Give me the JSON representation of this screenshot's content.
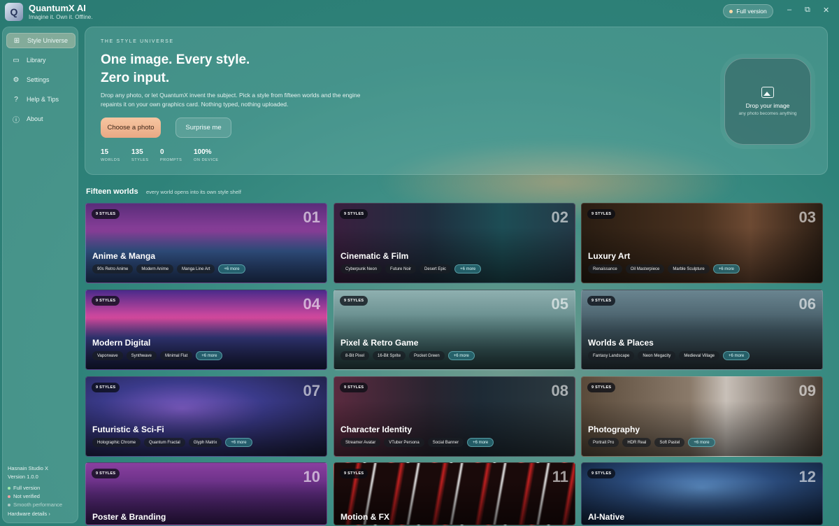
{
  "app": {
    "name": "QuantumX AI",
    "tagline": "Imagine it. Own it. Offline.",
    "logo_glyph": "Q",
    "version_pill": "Full version",
    "window_controls": {
      "minimize": "–",
      "maximize": "⧉",
      "close": "✕"
    }
  },
  "sidebar": {
    "items": [
      {
        "label": "Style Universe",
        "icon": "grid-icon",
        "glyph": "⊞",
        "active": true
      },
      {
        "label": "Library",
        "icon": "folder-icon",
        "glyph": "▭",
        "active": false
      },
      {
        "label": "Settings",
        "icon": "gear-icon",
        "glyph": "⚙",
        "active": false
      },
      {
        "label": "Help & Tips",
        "icon": "question-icon",
        "glyph": "?",
        "active": false
      },
      {
        "label": "About",
        "icon": "info-icon",
        "glyph": "ⓘ",
        "active": false
      }
    ],
    "footer": {
      "studio": "Hasnain Studio X",
      "version": "Version 1.0.0",
      "status_full": "Full version",
      "status_verified": "Not verified",
      "status_perf": "Smooth performance",
      "hardware_link": "Hardware details ›"
    }
  },
  "hero": {
    "eyebrow": "THE STYLE UNIVERSE",
    "headline_line1": "One image. Every style.",
    "headline_line2": "Zero input.",
    "description": "Drop any photo, or let QuantumX invent the subject. Pick a style from fifteen worlds and the engine repaints it on your own graphics card. Nothing typed, nothing uploaded.",
    "primary_button": "Choose a photo",
    "secondary_button": "Surprise me",
    "stats": [
      {
        "value": "15",
        "label": "WORLDS"
      },
      {
        "value": "135",
        "label": "STYLES"
      },
      {
        "value": "0",
        "label": "PROMPTS"
      },
      {
        "value": "100%",
        "label": "ON DEVICE"
      }
    ],
    "drop_zone": {
      "title": "Drop your image",
      "subtitle": "any photo becomes anything"
    }
  },
  "worlds_section": {
    "title": "Fifteen worlds",
    "subtitle": "every world opens into its own style shelf"
  },
  "worlds": [
    {
      "num": "01",
      "name": "Anime & Manga",
      "badge": "9 STYLES",
      "chips": [
        "90s Retro Anime",
        "Modern Anime",
        "Manga Line Art"
      ],
      "more": "+6 more",
      "bg": "linear-gradient(180deg,#5a2d7a 0%,#8a3f9a 35%,#3a5f9a 60%,#27406f 100%)"
    },
    {
      "num": "02",
      "name": "Cinematic & Film",
      "badge": "9 STYLES",
      "chips": [
        "Cyberpunk Neon",
        "Future Noir",
        "Desert Epic"
      ],
      "more": "+6 more",
      "bg": "linear-gradient(90deg,#3a1f3f 0%,#1f2f3f 40%,#1d4d55 70%,#243a48 100%)"
    },
    {
      "num": "03",
      "name": "Luxury Art",
      "badge": "9 STYLES",
      "chips": [
        "Renaissance",
        "Oil Masterpiece",
        "Marble Sculpture"
      ],
      "more": "+6 more",
      "bg": "linear-gradient(90deg,#2a1d12 0%,#4a3220 50%,#6d4a33 70%,#2b1e14 100%)"
    },
    {
      "num": "04",
      "name": "Modern Digital",
      "badge": "9 STYLES",
      "chips": [
        "Vaporwave",
        "Synthwave",
        "Minimal Flat"
      ],
      "more": "+6 more",
      "bg": "linear-gradient(180deg,#4a2a8a 0%,#d84aa0 35%,#3a3f8a 60%,#1a2046 100%)"
    },
    {
      "num": "05",
      "name": "Pixel & Retro Game",
      "badge": "9 STYLES",
      "chips": [
        "8-Bit Pixel",
        "16-Bit Sprite",
        "Pocket Green"
      ],
      "more": "+6 more",
      "bg": "linear-gradient(180deg,#8fb0b0 0%,#5d8585 45%,#3b5e60 75%,#2a4446 100%)"
    },
    {
      "num": "06",
      "name": "Worlds & Places",
      "badge": "9 STYLES",
      "chips": [
        "Fantasy Landscape",
        "Neon Megacity",
        "Medieval Village"
      ],
      "more": "+6 more",
      "bg": "linear-gradient(180deg,#6a8590 0%,#3f5560 50%,#2a363d 100%)"
    },
    {
      "num": "07",
      "name": "Futuristic & Sci-Fi",
      "badge": "9 STYLES",
      "chips": [
        "Holographic Chrome",
        "Quantum Fractal",
        "Glyph Matrix"
      ],
      "more": "+6 more",
      "bg": "radial-gradient(ellipse at 40% 40%,#7a5ac0 0%,#3a3a8a 40%,#1a1d3a 100%)"
    },
    {
      "num": "08",
      "name": "Character Identity",
      "badge": "9 STYLES",
      "chips": [
        "Streamer Avatar",
        "VTuber Persona",
        "Social Banner"
      ],
      "more": "+6 more",
      "bg": "linear-gradient(90deg,#5a2a3f 0%,#2a2430 40%,#1d2a35 60%,#2d3a40 100%)"
    },
    {
      "num": "09",
      "name": "Photography",
      "badge": "9 STYLES",
      "chips": [
        "Portrait Pro",
        "HDR Real",
        "Soft Pastel"
      ],
      "more": "+6 more",
      "bg": "linear-gradient(90deg,#5a4a3a 0%,#8a7a6a 45%,#c8c0b8 60%,#4a3d33 100%)"
    },
    {
      "num": "10",
      "name": "Poster & Branding",
      "badge": "9 STYLES",
      "chips": [],
      "more": "",
      "bg": "linear-gradient(180deg,#8a3fa0 0%,#5a2a7a 50%,#3a1d5a 100%)"
    },
    {
      "num": "11",
      "name": "Motion & FX",
      "badge": "9 STYLES",
      "chips": [],
      "more": "",
      "bg": "repeating-linear-gradient(100deg,#1a0a0a 0px,#1a0a0a 30px,#c02020 34px,#1a0a0a 40px,#1a0a0a 55px,#eaeaea 58px,#1a0a0a 61px)"
    },
    {
      "num": "12",
      "name": "AI-Native",
      "badge": "9 STYLES",
      "chips": [],
      "more": "",
      "bg": "radial-gradient(ellipse at 50% 40%,#5a8ac0 0%,#2a4a7a 45%,#0e1d35 100%)"
    }
  ]
}
